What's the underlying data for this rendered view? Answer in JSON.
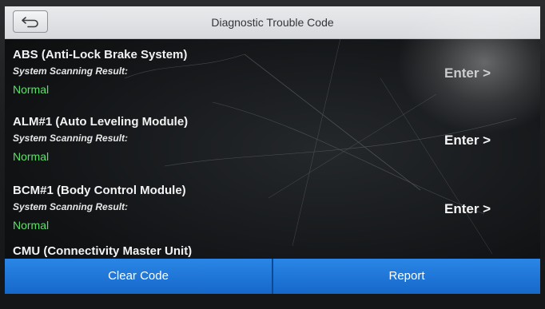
{
  "header": {
    "title": "Diagnostic Trouble Code",
    "back_icon": "back-arrow-icon"
  },
  "systems": [
    {
      "name": "ABS (Anti-Lock Brake System)",
      "result_label": "System Scanning Result:",
      "status": "Normal",
      "action_label": "Enter >"
    },
    {
      "name": "ALM#1 (Auto Leveling Module)",
      "result_label": "System Scanning Result:",
      "status": "Normal",
      "action_label": "Enter >"
    },
    {
      "name": "BCM#1 (Body Control Module)",
      "result_label": "System Scanning Result:",
      "status": "Normal",
      "action_label": "Enter >"
    }
  ],
  "partial_item": {
    "name": "CMU (Connectivity Master Unit)"
  },
  "footer": {
    "clear_label": "Clear Code",
    "report_label": "Report"
  },
  "colors": {
    "header_bg": "#e0e2e5",
    "footer_button": "#1f78dc",
    "status_normal": "#5ee06a",
    "text_primary": "#f2f2f2"
  }
}
